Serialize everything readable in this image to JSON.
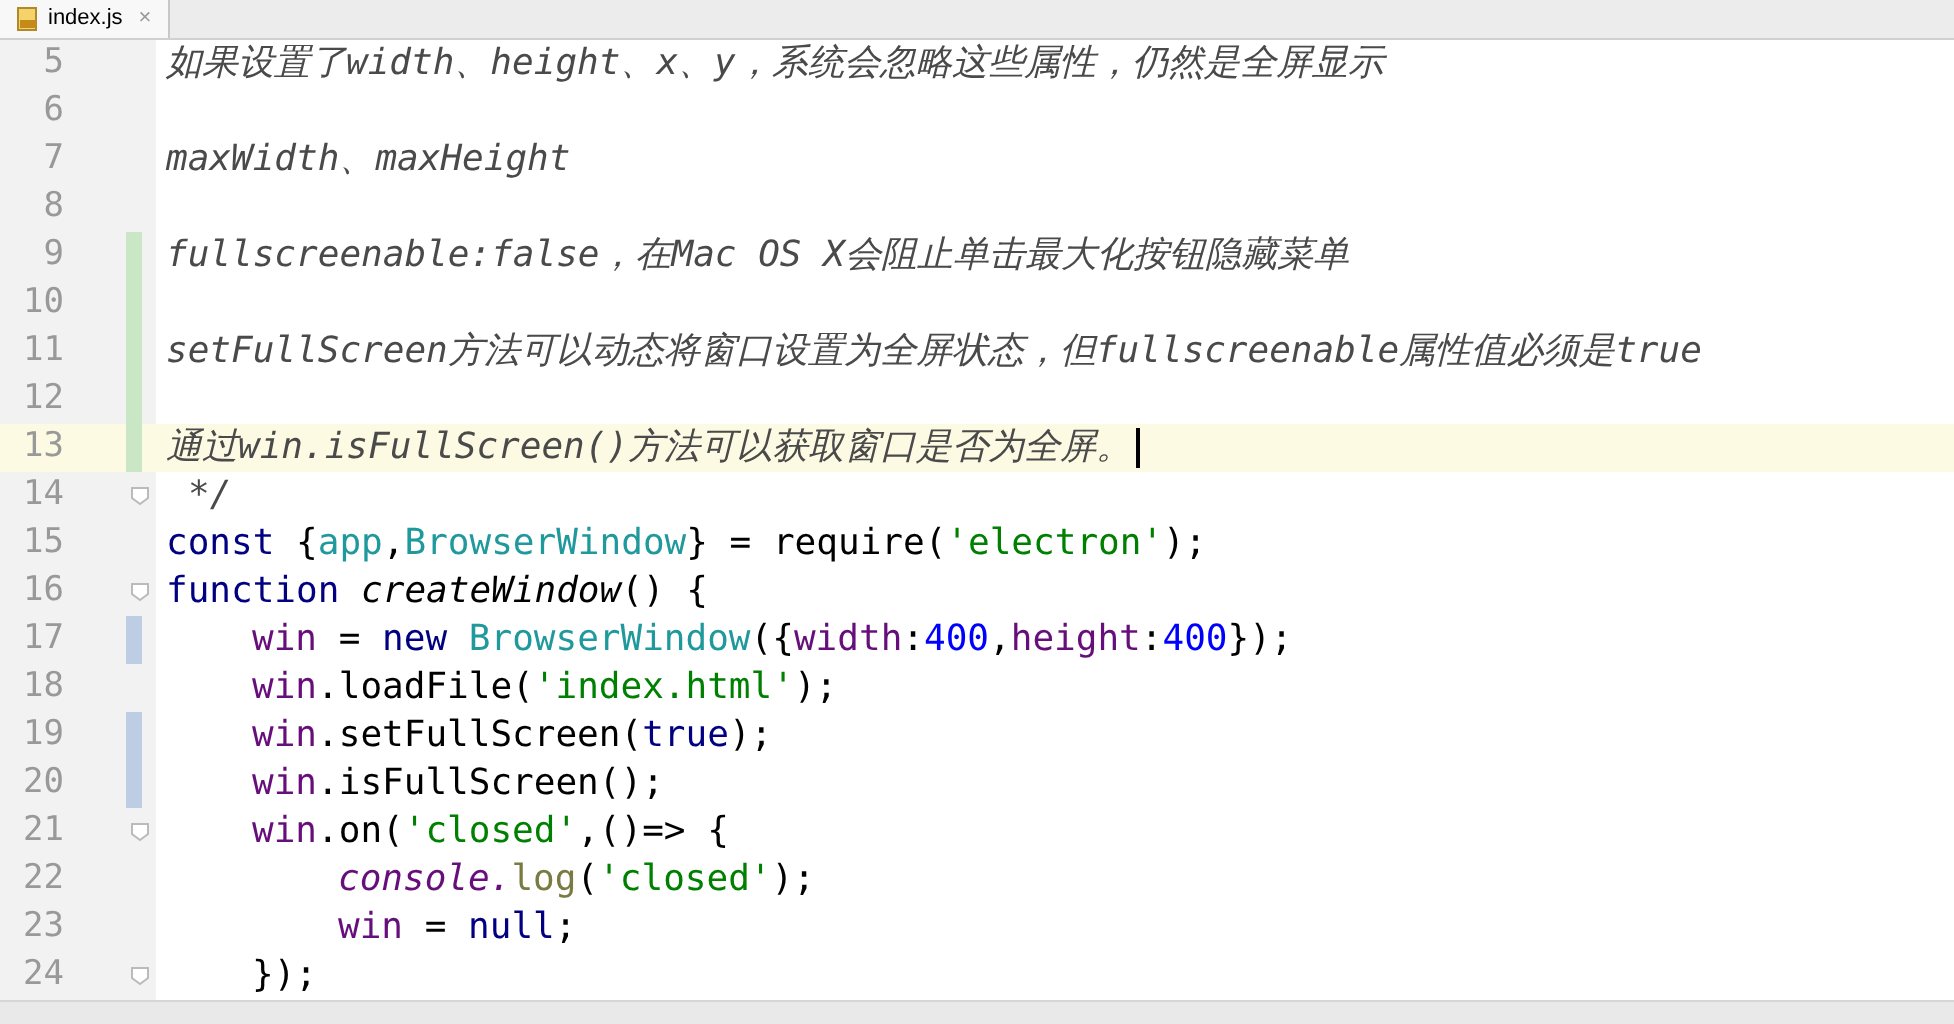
{
  "tab": {
    "label": "index.js",
    "close": "×",
    "selected": true
  },
  "lines": [
    {
      "number": "5",
      "added": false,
      "modified": false,
      "current": false,
      "fold": false,
      "kind": "flush",
      "tokens": [
        {
          "kind": "comment",
          "text": "如果设置了width、height、x、y，系统会忽略这些属性，仍然是全屏显示"
        }
      ]
    },
    {
      "number": "6",
      "added": false,
      "modified": false,
      "current": false,
      "fold": false
    },
    {
      "number": "7",
      "added": false,
      "modified": false,
      "current": false,
      "fold": false,
      "kind": "flush",
      "tokens": [
        {
          "kind": "comment",
          "text": "maxWidth、maxHeight"
        }
      ]
    },
    {
      "number": "8",
      "added": false,
      "modified": false,
      "current": false,
      "fold": false
    },
    {
      "number": "9",
      "added": true,
      "modified": false,
      "current": false,
      "fold": false,
      "kind": "flush",
      "tokens": [
        {
          "kind": "comment",
          "text": "fullscreenable:false，在Mac OS X会阻止单击最大化按钮隐藏菜单"
        }
      ]
    },
    {
      "number": "10",
      "added": true,
      "modified": false,
      "current": false,
      "fold": false
    },
    {
      "number": "11",
      "added": true,
      "modified": false,
      "current": false,
      "fold": false,
      "kind": "flush",
      "tokens": [
        {
          "kind": "comment",
          "text": "setFullScreen方法可以动态将窗口设置为全屏状态，但fullscreenable属性值必须是true"
        }
      ]
    },
    {
      "number": "12",
      "added": true,
      "modified": false,
      "current": false,
      "fold": false
    },
    {
      "number": "13",
      "added": true,
      "modified": false,
      "current": true,
      "fold": false,
      "kind": "flush",
      "tokens": [
        {
          "kind": "comment",
          "text": "通过win.isFullScreen()方法可以获取窗口是否为全屏。"
        }
      ]
    },
    {
      "number": "14",
      "added": false,
      "modified": false,
      "current": false,
      "fold": true,
      "kind": "space",
      "tokens": [
        {
          "kind": "comment",
          "text": "*/"
        }
      ]
    },
    {
      "number": "15",
      "added": false,
      "modified": false,
      "current": false,
      "fold": false,
      "kind": "flush",
      "tokens": [
        {
          "kind": "keyword",
          "text": "const "
        },
        {
          "kind": "plain",
          "text": "{"
        },
        {
          "kind": "class",
          "text": "app"
        },
        {
          "kind": "plain",
          "text": ","
        },
        {
          "kind": "class",
          "text": "BrowserWindow"
        },
        {
          "kind": "plain",
          "text": "} = require("
        },
        {
          "kind": "string",
          "text": "'electron'"
        },
        {
          "kind": "plain",
          "text": ");"
        }
      ]
    },
    {
      "number": "16",
      "added": false,
      "modified": false,
      "current": false,
      "fold": true,
      "kind": "flush",
      "tokens": [
        {
          "kind": "keyword",
          "text": "function "
        },
        {
          "kind": "italic",
          "text": "createWindow"
        },
        {
          "kind": "plain",
          "text": "() {"
        }
      ]
    },
    {
      "number": "17",
      "added": false,
      "modified": true,
      "current": false,
      "fold": false,
      "kind": "indented",
      "tokens": [
        {
          "kind": "var",
          "text": "win"
        },
        {
          "kind": "plain",
          "text": " = "
        },
        {
          "kind": "keyword",
          "text": "new "
        },
        {
          "kind": "class",
          "text": "BrowserWindow"
        },
        {
          "kind": "plain",
          "text": "({"
        },
        {
          "kind": "var",
          "text": "width"
        },
        {
          "kind": "plain",
          "text": ":"
        },
        {
          "kind": "number",
          "text": "400"
        },
        {
          "kind": "plain",
          "text": ","
        },
        {
          "kind": "var",
          "text": "height"
        },
        {
          "kind": "plain",
          "text": ":"
        },
        {
          "kind": "number",
          "text": "400"
        },
        {
          "kind": "plain",
          "text": "});"
        }
      ]
    },
    {
      "number": "18",
      "added": false,
      "modified": false,
      "current": false,
      "fold": false,
      "kind": "indented",
      "tokens": [
        {
          "kind": "var",
          "text": "win"
        },
        {
          "kind": "plain",
          "text": ".loadFile("
        },
        {
          "kind": "string",
          "text": "'index.html'"
        },
        {
          "kind": "plain",
          "text": ");"
        }
      ]
    },
    {
      "number": "19",
      "added": false,
      "modified": true,
      "current": false,
      "fold": false,
      "kind": "indented",
      "tokens": [
        {
          "kind": "var",
          "text": "win"
        },
        {
          "kind": "plain",
          "text": ".setFullScreen("
        },
        {
          "kind": "keyword",
          "text": "true"
        },
        {
          "kind": "plain",
          "text": ");"
        }
      ]
    },
    {
      "number": "20",
      "added": false,
      "modified": true,
      "current": false,
      "fold": false,
      "kind": "indented",
      "tokens": [
        {
          "kind": "var",
          "text": "win"
        },
        {
          "kind": "plain",
          "text": ".isFullScreen();"
        }
      ]
    },
    {
      "number": "21",
      "added": false,
      "modified": false,
      "current": false,
      "fold": true,
      "kind": "indented",
      "tokens": [
        {
          "kind": "var",
          "text": "win"
        },
        {
          "kind": "plain",
          "text": ".on("
        },
        {
          "kind": "string",
          "text": "'closed'"
        },
        {
          "kind": "plain",
          "text": ",()=> {"
        }
      ]
    },
    {
      "number": "22",
      "added": false,
      "modified": false,
      "current": false,
      "fold": false,
      "kind": "deep",
      "tokens": [
        {
          "kind": "global",
          "text": "console."
        },
        {
          "kind": "method",
          "text": "log"
        },
        {
          "kind": "plain",
          "text": "("
        },
        {
          "kind": "string",
          "text": "'closed'"
        },
        {
          "kind": "plain",
          "text": ");"
        }
      ]
    },
    {
      "number": "23",
      "added": false,
      "modified": false,
      "current": false,
      "fold": false,
      "kind": "deep",
      "tokens": [
        {
          "kind": "var",
          "text": "win"
        },
        {
          "kind": "plain",
          "text": " = "
        },
        {
          "kind": "keyword",
          "text": "null"
        },
        {
          "kind": "plain",
          "text": ";"
        }
      ]
    },
    {
      "number": "24",
      "added": false,
      "modified": false,
      "current": false,
      "fold": true,
      "kind": "indented",
      "tokens": [
        {
          "kind": "plain",
          "text": "});"
        }
      ]
    }
  ]
}
